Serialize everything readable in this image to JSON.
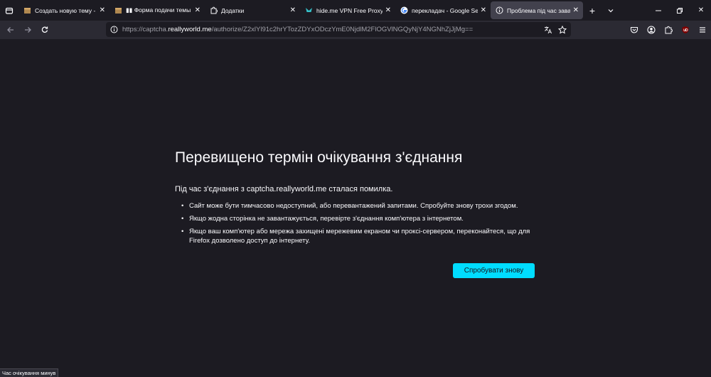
{
  "tabs": [
    {
      "title": "Создать новую тему - Real",
      "favicon": "box-icon"
    },
    {
      "title": "▮▮ Форма подачи темы о н",
      "favicon": "box-icon"
    },
    {
      "title": "Додатки",
      "favicon": "puzzle-icon"
    },
    {
      "title": "hide.me VPN Free Proxy – О",
      "favicon": "hideme-icon"
    },
    {
      "title": "перекладач - Google Search",
      "favicon": "google-icon"
    },
    {
      "title": "Проблема під час завантаж",
      "favicon": "info-icon"
    }
  ],
  "address_bar": {
    "url_prefix": "https://captcha.",
    "url_domain": "reallyworld.me",
    "url_suffix": "/authorize/Z2xlYl91c2hrYTozZDYxODczYmE0NjdlM2FlOGVlNGQyNjY4NGNhZjJjMg=="
  },
  "error_page": {
    "title": "Перевищено термін очікування з'єднання",
    "description": "Під час з'єднання з captcha.reallyworld.me сталася помилка.",
    "bullets": [
      "Сайт може бути тимчасово недоступний, або перевантажений запитами. Спробуйте знову трохи згодом.",
      "Якщо жодна сторінка не завантажується, перевірте з'єднання комп'ютера з інтернетом.",
      "Якщо ваш комп'ютер або мережа захищені мережевим екраном чи проксі-сервером, переконайтеся, що для Firefox дозволено доступ до інтернету."
    ],
    "retry_label": "Спробувати знову"
  },
  "status_bar": {
    "text": "Час очікування минув"
  },
  "colors": {
    "accent": "#00ddff",
    "background": "#1c1b22",
    "toolbar": "#2b2a33",
    "active_tab": "#42414d"
  }
}
